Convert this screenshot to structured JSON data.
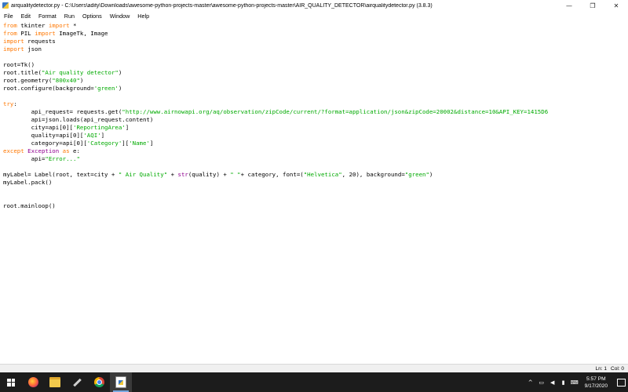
{
  "window": {
    "title": "airqualitydetector.py - C:\\Users\\adity\\Downloads\\awesome-python-projects-master\\awesome-python-projects-master\\AIR_QUALITY_DETECTOR\\airqualitydetector.py (3.8.3)",
    "controls": {
      "minimize": "—",
      "maximize": "❐",
      "close": "✕"
    }
  },
  "menu": [
    "File",
    "Edit",
    "Format",
    "Run",
    "Options",
    "Window",
    "Help"
  ],
  "code_lines": [
    [
      {
        "t": "kw",
        "s": "from"
      },
      {
        "t": "p",
        "s": " tkinter "
      },
      {
        "t": "kw",
        "s": "import"
      },
      {
        "t": "p",
        "s": " *"
      }
    ],
    [
      {
        "t": "kw",
        "s": "from"
      },
      {
        "t": "p",
        "s": " PIL "
      },
      {
        "t": "kw",
        "s": "import"
      },
      {
        "t": "p",
        "s": " ImageTk, Image"
      }
    ],
    [
      {
        "t": "kw",
        "s": "import"
      },
      {
        "t": "p",
        "s": " requests"
      }
    ],
    [
      {
        "t": "kw",
        "s": "import"
      },
      {
        "t": "p",
        "s": " json"
      }
    ],
    [],
    [
      {
        "t": "p",
        "s": "root=Tk()"
      }
    ],
    [
      {
        "t": "p",
        "s": "root.title("
      },
      {
        "t": "str",
        "s": "\"Air quality detector\""
      },
      {
        "t": "p",
        "s": ")"
      }
    ],
    [
      {
        "t": "p",
        "s": "root.geometry("
      },
      {
        "t": "str",
        "s": "\"800x40\""
      },
      {
        "t": "p",
        "s": ")"
      }
    ],
    [
      {
        "t": "p",
        "s": "root.configure(background="
      },
      {
        "t": "str",
        "s": "'green'"
      },
      {
        "t": "p",
        "s": ")"
      }
    ],
    [],
    [
      {
        "t": "kw",
        "s": "try"
      },
      {
        "t": "p",
        "s": ":"
      }
    ],
    [
      {
        "t": "p",
        "s": "        api_request= requests.get("
      },
      {
        "t": "str",
        "s": "\"http://www.airnowapi.org/aq/observation/zipCode/current/?format=application/json&zipCode=20002&distance=10&API_KEY=1415D6"
      }
    ],
    [
      {
        "t": "p",
        "s": "        api=json.loads(api_request.content)"
      }
    ],
    [
      {
        "t": "p",
        "s": "        city=api[0]["
      },
      {
        "t": "str",
        "s": "'ReportingArea'"
      },
      {
        "t": "p",
        "s": "]"
      }
    ],
    [
      {
        "t": "p",
        "s": "        quality=api[0]["
      },
      {
        "t": "str",
        "s": "'AQI'"
      },
      {
        "t": "p",
        "s": "]"
      }
    ],
    [
      {
        "t": "p",
        "s": "        category=api[0]["
      },
      {
        "t": "str",
        "s": "'Category'"
      },
      {
        "t": "p",
        "s": "]["
      },
      {
        "t": "str",
        "s": "'Name'"
      },
      {
        "t": "p",
        "s": "]"
      }
    ],
    [
      {
        "t": "kw",
        "s": "except"
      },
      {
        "t": "p",
        "s": " "
      },
      {
        "t": "bi",
        "s": "Exception"
      },
      {
        "t": "p",
        "s": " "
      },
      {
        "t": "kw",
        "s": "as"
      },
      {
        "t": "p",
        "s": " e:"
      }
    ],
    [
      {
        "t": "p",
        "s": "        api="
      },
      {
        "t": "str",
        "s": "\"Error...\""
      }
    ],
    [],
    [
      {
        "t": "p",
        "s": "myLabel= Label(root, text=city + "
      },
      {
        "t": "str",
        "s": "\" Air Quality\""
      },
      {
        "t": "p",
        "s": " + "
      },
      {
        "t": "bi",
        "s": "str"
      },
      {
        "t": "p",
        "s": "(quality) + "
      },
      {
        "t": "str",
        "s": "\" \""
      },
      {
        "t": "p",
        "s": "+ category, font=("
      },
      {
        "t": "str",
        "s": "\"Helvetica\""
      },
      {
        "t": "p",
        "s": ", 20), background="
      },
      {
        "t": "str",
        "s": "\"green\""
      },
      {
        "t": "p",
        "s": ")"
      }
    ],
    [
      {
        "t": "p",
        "s": "myLabel.pack()"
      }
    ],
    [],
    [],
    [
      {
        "t": "p",
        "s": "root.mainloop()"
      }
    ]
  ],
  "status": {
    "line": "Ln: 1",
    "col": "Col: 0"
  },
  "taskbar": {
    "apps": [
      {
        "name": "start-button",
        "icon": "windows-logo-icon"
      },
      {
        "name": "taskbar-firefox",
        "icon": "firefox-icon"
      },
      {
        "name": "taskbar-file-explorer",
        "icon": "folder-icon"
      },
      {
        "name": "taskbar-tool",
        "icon": "wrench-icon"
      },
      {
        "name": "taskbar-chrome",
        "icon": "chrome-icon"
      },
      {
        "name": "taskbar-python-editor",
        "icon": "python-file-icon",
        "active": true
      }
    ],
    "tray_glyphs": {
      "chevron": "^",
      "network": "▭",
      "volume": "◀",
      "battery": "▮",
      "keyboard": "⌨"
    },
    "clock": {
      "time": "5:57 PM",
      "date": "9/17/2020"
    }
  },
  "colors": {
    "keyword": "#ff7700",
    "builtin": "#900090",
    "string": "#00aa00",
    "taskbar": "#1c1c1c"
  }
}
